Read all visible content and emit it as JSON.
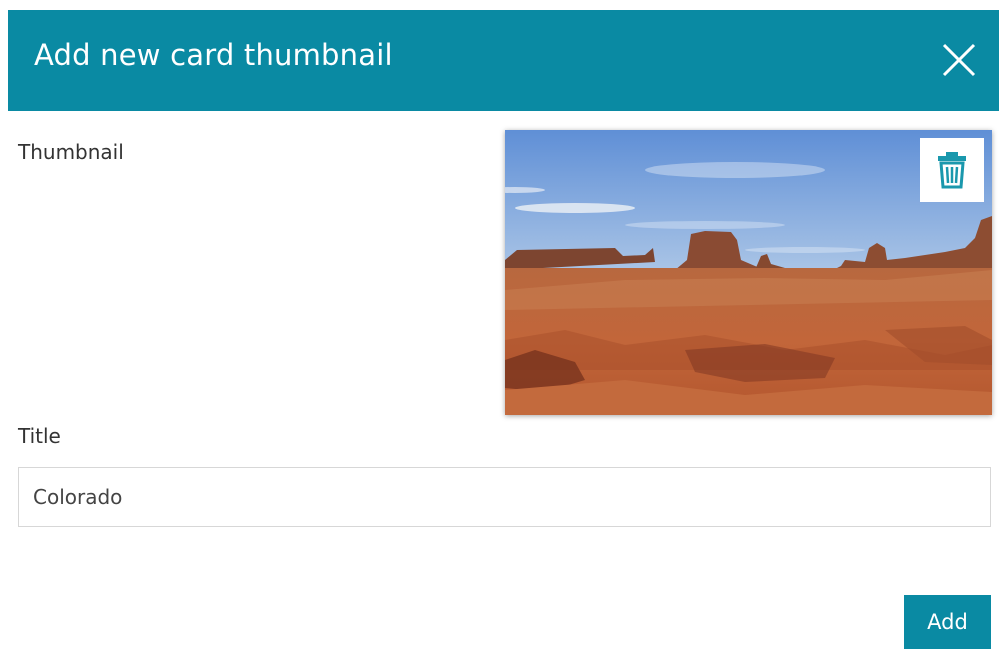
{
  "dialog": {
    "title": "Add new card thumbnail",
    "close_icon": "close-icon",
    "accent_color": "#0a8aa3"
  },
  "form": {
    "thumbnail_label": "Thumbnail",
    "thumbnail_image": "desert-mesa-landscape-photo",
    "delete_icon": "trash-icon",
    "title_label": "Title",
    "title_value": "Colorado"
  },
  "actions": {
    "add_label": "Add"
  }
}
